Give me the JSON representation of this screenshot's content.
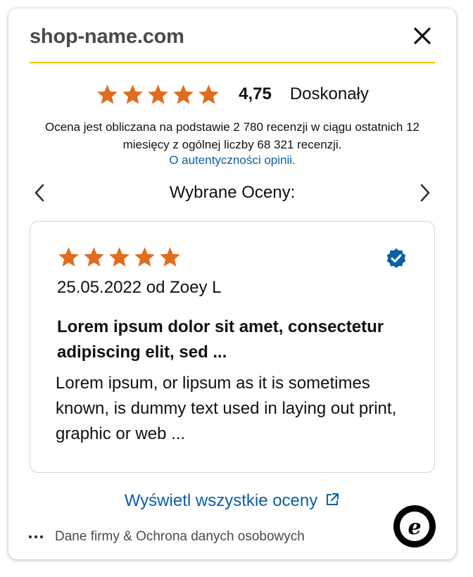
{
  "header": {
    "shop_name": "shop-name.com",
    "close_icon": "close-icon",
    "accent_color": "#f2c500"
  },
  "summary": {
    "rating_stars": 5,
    "score": "4,75",
    "grade": "Doskonały",
    "description": "Ocena jest obliczana na podstawie 2 780 recenzji w ciągu ostatnich 12 miesięcy z ogólnej liczby 68 321 recenzji.",
    "authenticity_link": "O autentyczności opinii.",
    "star_color": "#e06d1f",
    "link_color": "#0a5fa8"
  },
  "carousel": {
    "title": "Wybrane Oceny:",
    "prev_icon": "chevron-left-icon",
    "next_icon": "chevron-right-icon"
  },
  "review": {
    "rating_stars": 5,
    "verified_icon": "verified-badge-icon",
    "meta": "25.05.2022 od Zoey L",
    "title": "Lorem ipsum dolor sit amet, consectetur adipiscing elit, sed ...",
    "body": "Lorem ipsum, or lipsum as it is sometimes known, is dummy text used in laying out print, graphic or web ..."
  },
  "footer": {
    "all_reviews_link": "Wyświetl wszystkie oceny",
    "external_icon": "external-link-icon",
    "more_icon": "more-dots-icon",
    "legal_link": "Dane firmy & Ochrona danych osobowych",
    "logo_icon": "trusted-shops-logo-icon",
    "logo_letter": "e"
  }
}
